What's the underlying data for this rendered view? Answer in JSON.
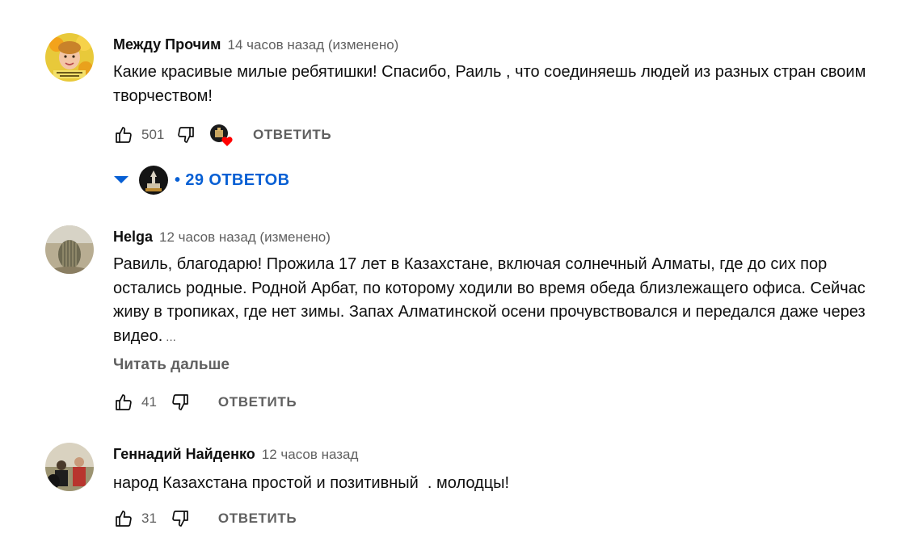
{
  "comments": [
    {
      "author": "Между Прочим",
      "time": "14 часов назад (изменено)",
      "text": "Какие красивые милые ребятишки! Спасибо, Раиль , что соединяешь людей из разных стран своим творчеством!",
      "likes": "501",
      "reply_label": "ОТВЕТИТЬ",
      "avatar_icon": "child-portrait-avatar",
      "creator_heart": true,
      "replies_label": "• 29 ОТВЕТОВ"
    },
    {
      "author": "Helga",
      "time": "12 часов назад (изменено)",
      "text": "Равиль, благодарю! Прожила 17 лет в Казахстане, включая солнечный Алматы, где до сих пор остались родные. Родной Арбат, по которому ходили во время обеда близлежащего офиса. Сейчас живу в тропиках, где нет зимы. Запах Алматинской осени прочувствовался и передался даже через видео.",
      "ellipsis": "...",
      "read_more": "Читать дальше",
      "likes": "41",
      "reply_label": "ОТВЕТИТЬ",
      "avatar_icon": "cactus-avatar"
    },
    {
      "author": "Геннадий Найденко",
      "time": "12 часов назад",
      "text": "народ Казахстана простой и позитивный  . молодцы!",
      "likes": "31",
      "reply_label": "ОТВЕТИТЬ",
      "avatar_icon": "group-photo-avatar"
    }
  ],
  "colors": {
    "link_blue": "#065fd4",
    "secondary_text": "#606060",
    "heart_red": "#ff0000"
  }
}
